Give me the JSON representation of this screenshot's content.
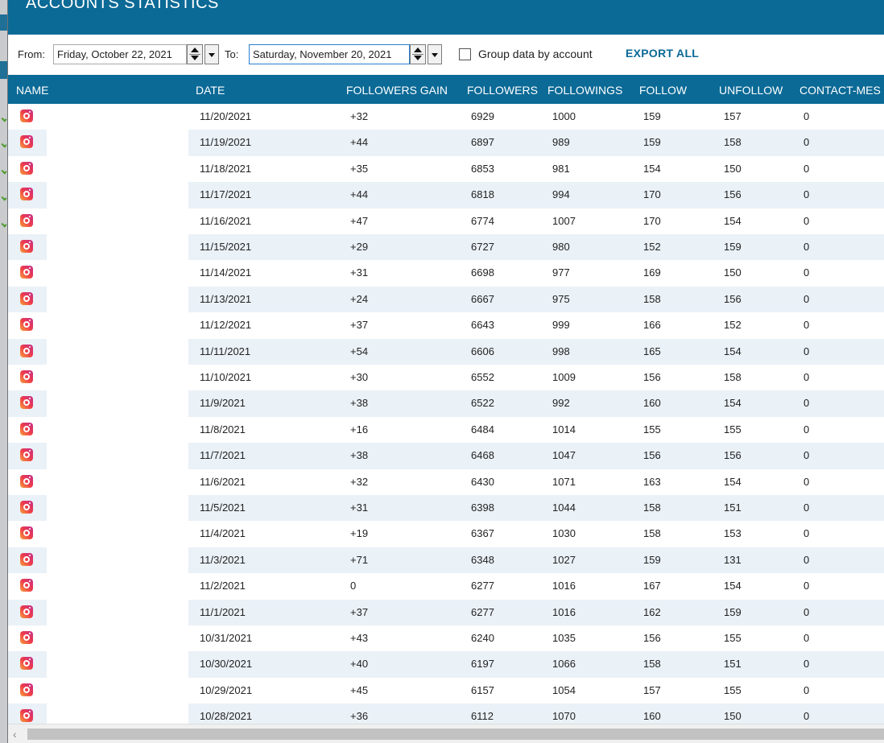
{
  "window": {
    "title": "ACCOUNTS STATISTICS"
  },
  "toolbar": {
    "from_label": "From:",
    "from_date": "Friday, October 22, 2021",
    "to_label": "To:",
    "to_date": "Saturday, November 20, 2021",
    "group_label": "Group data by account",
    "group_checked": false,
    "export_label": "EXPORT ALL"
  },
  "table": {
    "columns": [
      "NAME",
      "DATE",
      "FOLLOWERS GAIN",
      "FOLLOWERS",
      "FOLLOWINGS",
      "FOLLOW",
      "UNFOLLOW",
      "CONTACT-MES"
    ],
    "rows": [
      {
        "date": "11/20/2021",
        "gain": "+32",
        "followers": "6929",
        "followings": "1000",
        "follow": "159",
        "unfollow": "157",
        "contact": "0"
      },
      {
        "date": "11/19/2021",
        "gain": "+44",
        "followers": "6897",
        "followings": "989",
        "follow": "159",
        "unfollow": "158",
        "contact": "0"
      },
      {
        "date": "11/18/2021",
        "gain": "+35",
        "followers": "6853",
        "followings": "981",
        "follow": "154",
        "unfollow": "150",
        "contact": "0"
      },
      {
        "date": "11/17/2021",
        "gain": "+44",
        "followers": "6818",
        "followings": "994",
        "follow": "170",
        "unfollow": "156",
        "contact": "0"
      },
      {
        "date": "11/16/2021",
        "gain": "+47",
        "followers": "6774",
        "followings": "1007",
        "follow": "170",
        "unfollow": "154",
        "contact": "0"
      },
      {
        "date": "11/15/2021",
        "gain": "+29",
        "followers": "6727",
        "followings": "980",
        "follow": "152",
        "unfollow": "159",
        "contact": "0"
      },
      {
        "date": "11/14/2021",
        "gain": "+31",
        "followers": "6698",
        "followings": "977",
        "follow": "169",
        "unfollow": "150",
        "contact": "0"
      },
      {
        "date": "11/13/2021",
        "gain": "+24",
        "followers": "6667",
        "followings": "975",
        "follow": "158",
        "unfollow": "156",
        "contact": "0"
      },
      {
        "date": "11/12/2021",
        "gain": "+37",
        "followers": "6643",
        "followings": "999",
        "follow": "166",
        "unfollow": "152",
        "contact": "0"
      },
      {
        "date": "11/11/2021",
        "gain": "+54",
        "followers": "6606",
        "followings": "998",
        "follow": "165",
        "unfollow": "154",
        "contact": "0"
      },
      {
        "date": "11/10/2021",
        "gain": "+30",
        "followers": "6552",
        "followings": "1009",
        "follow": "156",
        "unfollow": "158",
        "contact": "0"
      },
      {
        "date": "11/9/2021",
        "gain": "+38",
        "followers": "6522",
        "followings": "992",
        "follow": "160",
        "unfollow": "154",
        "contact": "0"
      },
      {
        "date": "11/8/2021",
        "gain": "+16",
        "followers": "6484",
        "followings": "1014",
        "follow": "155",
        "unfollow": "155",
        "contact": "0"
      },
      {
        "date": "11/7/2021",
        "gain": "+38",
        "followers": "6468",
        "followings": "1047",
        "follow": "156",
        "unfollow": "156",
        "contact": "0"
      },
      {
        "date": "11/6/2021",
        "gain": "+32",
        "followers": "6430",
        "followings": "1071",
        "follow": "163",
        "unfollow": "154",
        "contact": "0"
      },
      {
        "date": "11/5/2021",
        "gain": "+31",
        "followers": "6398",
        "followings": "1044",
        "follow": "158",
        "unfollow": "151",
        "contact": "0"
      },
      {
        "date": "11/4/2021",
        "gain": "+19",
        "followers": "6367",
        "followings": "1030",
        "follow": "158",
        "unfollow": "153",
        "contact": "0"
      },
      {
        "date": "11/3/2021",
        "gain": "+71",
        "followers": "6348",
        "followings": "1027",
        "follow": "159",
        "unfollow": "131",
        "contact": "0"
      },
      {
        "date": "11/2/2021",
        "gain": "0",
        "followers": "6277",
        "followings": "1016",
        "follow": "167",
        "unfollow": "154",
        "contact": "0"
      },
      {
        "date": "11/1/2021",
        "gain": "+37",
        "followers": "6277",
        "followings": "1016",
        "follow": "162",
        "unfollow": "159",
        "contact": "0"
      },
      {
        "date": "10/31/2021",
        "gain": "+43",
        "followers": "6240",
        "followings": "1035",
        "follow": "156",
        "unfollow": "155",
        "contact": "0"
      },
      {
        "date": "10/30/2021",
        "gain": "+40",
        "followers": "6197",
        "followings": "1066",
        "follow": "158",
        "unfollow": "151",
        "contact": "0"
      },
      {
        "date": "10/29/2021",
        "gain": "+45",
        "followers": "6157",
        "followings": "1054",
        "follow": "157",
        "unfollow": "155",
        "contact": "0"
      },
      {
        "date": "10/28/2021",
        "gain": "+36",
        "followers": "6112",
        "followings": "1070",
        "follow": "160",
        "unfollow": "150",
        "contact": "0"
      }
    ],
    "row_icon": "instagram-icon"
  },
  "colors": {
    "accent": "#0b6a96",
    "row_alt": "#eaf1f7"
  }
}
